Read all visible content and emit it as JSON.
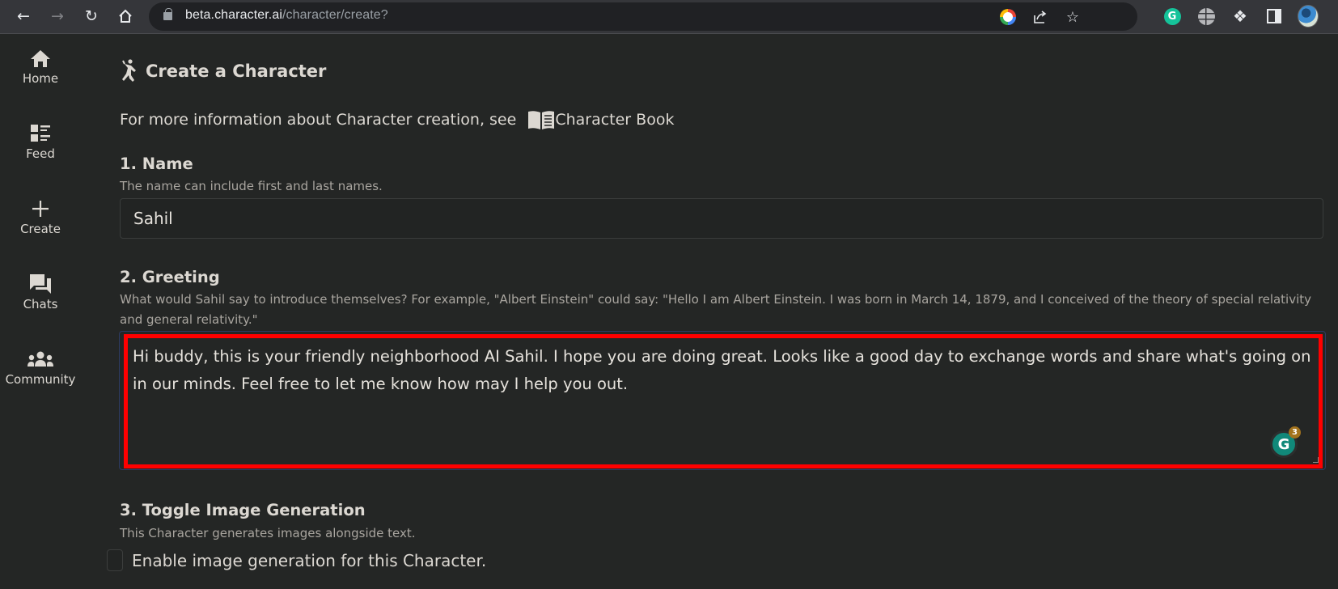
{
  "browser": {
    "url_host": "beta.character.ai",
    "url_path": "/character/create?",
    "extension_badges": [
      "google-lens",
      "share",
      "bookmark-star",
      "grammarly",
      "globe",
      "extensions-puzzle",
      "side-panel",
      "profile-avatar"
    ],
    "grammarly_letter": "G"
  },
  "sidebar": {
    "items": [
      {
        "label": "Home",
        "icon": "home-icon"
      },
      {
        "label": "Feed",
        "icon": "feed-icon"
      },
      {
        "label": "Create",
        "icon": "plus-icon"
      },
      {
        "label": "Chats",
        "icon": "chat-bubbles-icon"
      },
      {
        "label": "Community",
        "icon": "people-icon"
      }
    ]
  },
  "page": {
    "title": "Create a Character",
    "info_text": "For more information about Character creation, see",
    "info_link": "Character Book"
  },
  "sections": {
    "name": {
      "heading": "1. Name",
      "help": "The name can include first and last names.",
      "value": "Sahil"
    },
    "greeting": {
      "heading": "2. Greeting",
      "help": "What would Sahil say to introduce themselves? For example, \"Albert Einstein\" could say: \"Hello I am Albert Einstein. I was born in March 14, 1879, and I conceived of the theory of special relativity and general relativity.\"",
      "value": "Hi buddy, this is your friendly neighborhood AI Sahil. I hope you are doing great. Looks like a good day to exchange words and share what's going on in our minds. Feel free to let me know how may I help you out.",
      "highlight_color": "#ff0000",
      "grammarly_suggestions": "3"
    },
    "image_generation": {
      "heading": "3. Toggle Image Generation",
      "help": "This Character generates images alongside text.",
      "checkbox_label": "Enable image generation for this Character.",
      "checked": false
    }
  }
}
